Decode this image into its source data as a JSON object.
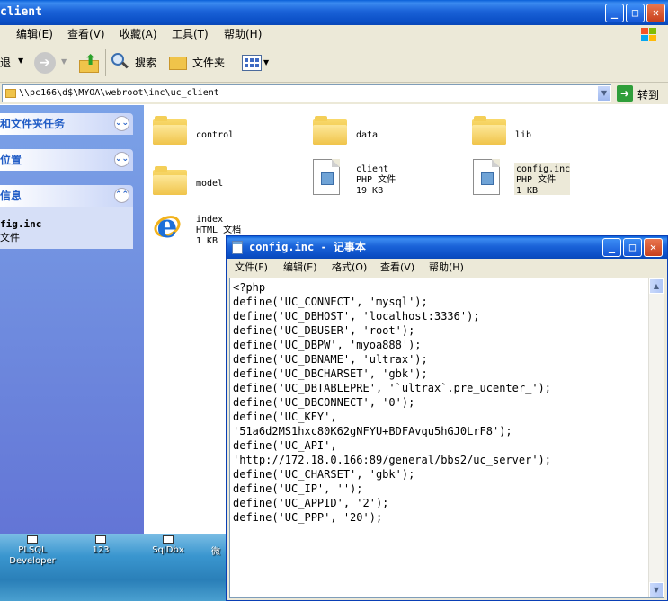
{
  "explorer": {
    "title": "client",
    "menu": [
      "编辑(E)",
      "查看(V)",
      "收藏(A)",
      "工具(T)",
      "帮助(H)"
    ],
    "toolbar": {
      "back_label": "退",
      "search_label": "搜索",
      "folders_label": "文件夹"
    },
    "address": {
      "path": "\\\\pc166\\d$\\MYOA\\webroot\\inc\\uc_client",
      "go_label": "转到"
    },
    "sidebar": {
      "tasks_title": "和文件夹任务",
      "places_title": "位置",
      "details_title": "信息",
      "details_name": "fig.inc",
      "details_type": "文件"
    },
    "files": [
      {
        "name": "control"
      },
      {
        "name": "data"
      },
      {
        "name": "lib"
      },
      {
        "name": "model"
      },
      {
        "name": "client",
        "type": "PHP 文件",
        "size": "19 KB"
      },
      {
        "name": "config.inc",
        "type": "PHP 文件",
        "size": "1 KB"
      },
      {
        "name": "index",
        "type": "HTML 文档",
        "size": "1 KB"
      }
    ]
  },
  "desktop": {
    "icons": [
      {
        "label1": "PLSQL",
        "label2": "Developer"
      },
      {
        "label1": "123",
        "label2": ""
      },
      {
        "label1": "SqlDbx",
        "label2": ""
      },
      {
        "label1": "微",
        "label2": ""
      }
    ]
  },
  "notepad": {
    "title": "config.inc - 记事本",
    "menu": [
      "文件(F)",
      "编辑(E)",
      "格式(O)",
      "查看(V)",
      "帮助(H)"
    ],
    "content": "<?php\ndefine('UC_CONNECT', 'mysql');\ndefine('UC_DBHOST', 'localhost:3336');\ndefine('UC_DBUSER', 'root');\ndefine('UC_DBPW', 'myoa888');\ndefine('UC_DBNAME', 'ultrax');\ndefine('UC_DBCHARSET', 'gbk');\ndefine('UC_DBTABLEPRE', '`ultrax`.pre_ucenter_');\ndefine('UC_DBCONNECT', '0');\ndefine('UC_KEY',\n'51a6d2MS1hxc80K62gNFYU+BDFAvqu5hGJ0LrF8');\ndefine('UC_API',\n'http://172.18.0.166:89/general/bbs2/uc_server');\ndefine('UC_CHARSET', 'gbk');\ndefine('UC_IP', '');\ndefine('UC_APPID', '2');\ndefine('UC_PPP', '20');"
  }
}
